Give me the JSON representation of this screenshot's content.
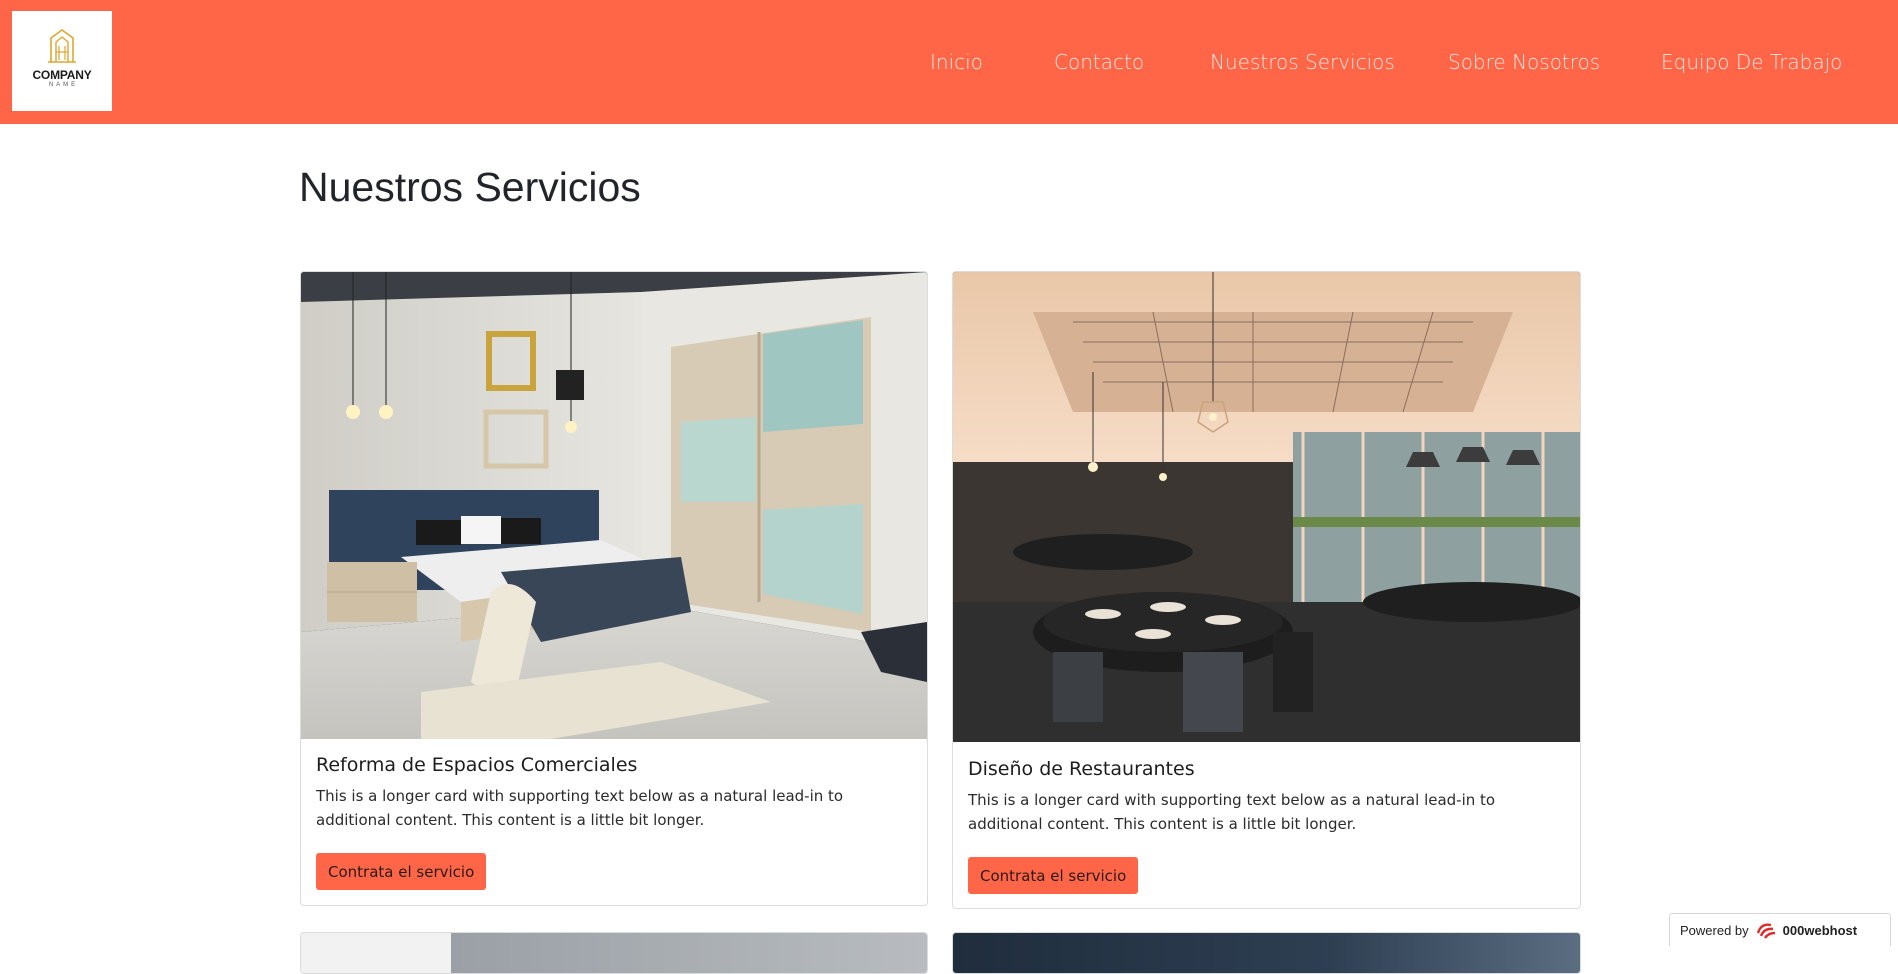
{
  "header": {
    "logo": {
      "text": "COMPANY",
      "sub": "NAME"
    },
    "nav": [
      {
        "label": "Inicio"
      },
      {
        "label": "Contacto"
      },
      {
        "label": "Nuestros Servicios"
      },
      {
        "label": "Sobre Nosotros"
      },
      {
        "label": "Equipo De Trabajo"
      }
    ]
  },
  "main": {
    "title": "Nuestros Servicios",
    "cards": [
      {
        "title": "Reforma de Espacios Comerciales",
        "text": "This is a longer card with supporting text below as a natural lead-in to additional content. This content is a little bit longer.",
        "button": "Contrata el servicio",
        "image": "bedroom-photo"
      },
      {
        "title": "Diseño de Restaurantes",
        "text": "This is a longer card with supporting text below as a natural lead-in to additional content. This content is a little bit longer.",
        "button": "Contrata el servicio",
        "image": "restaurant-photo"
      }
    ]
  },
  "footer_badge": {
    "label": "Powered by",
    "brand": "000webhost"
  },
  "colors": {
    "accent": "#ff6647",
    "nav_text": "#ffe4dc"
  }
}
